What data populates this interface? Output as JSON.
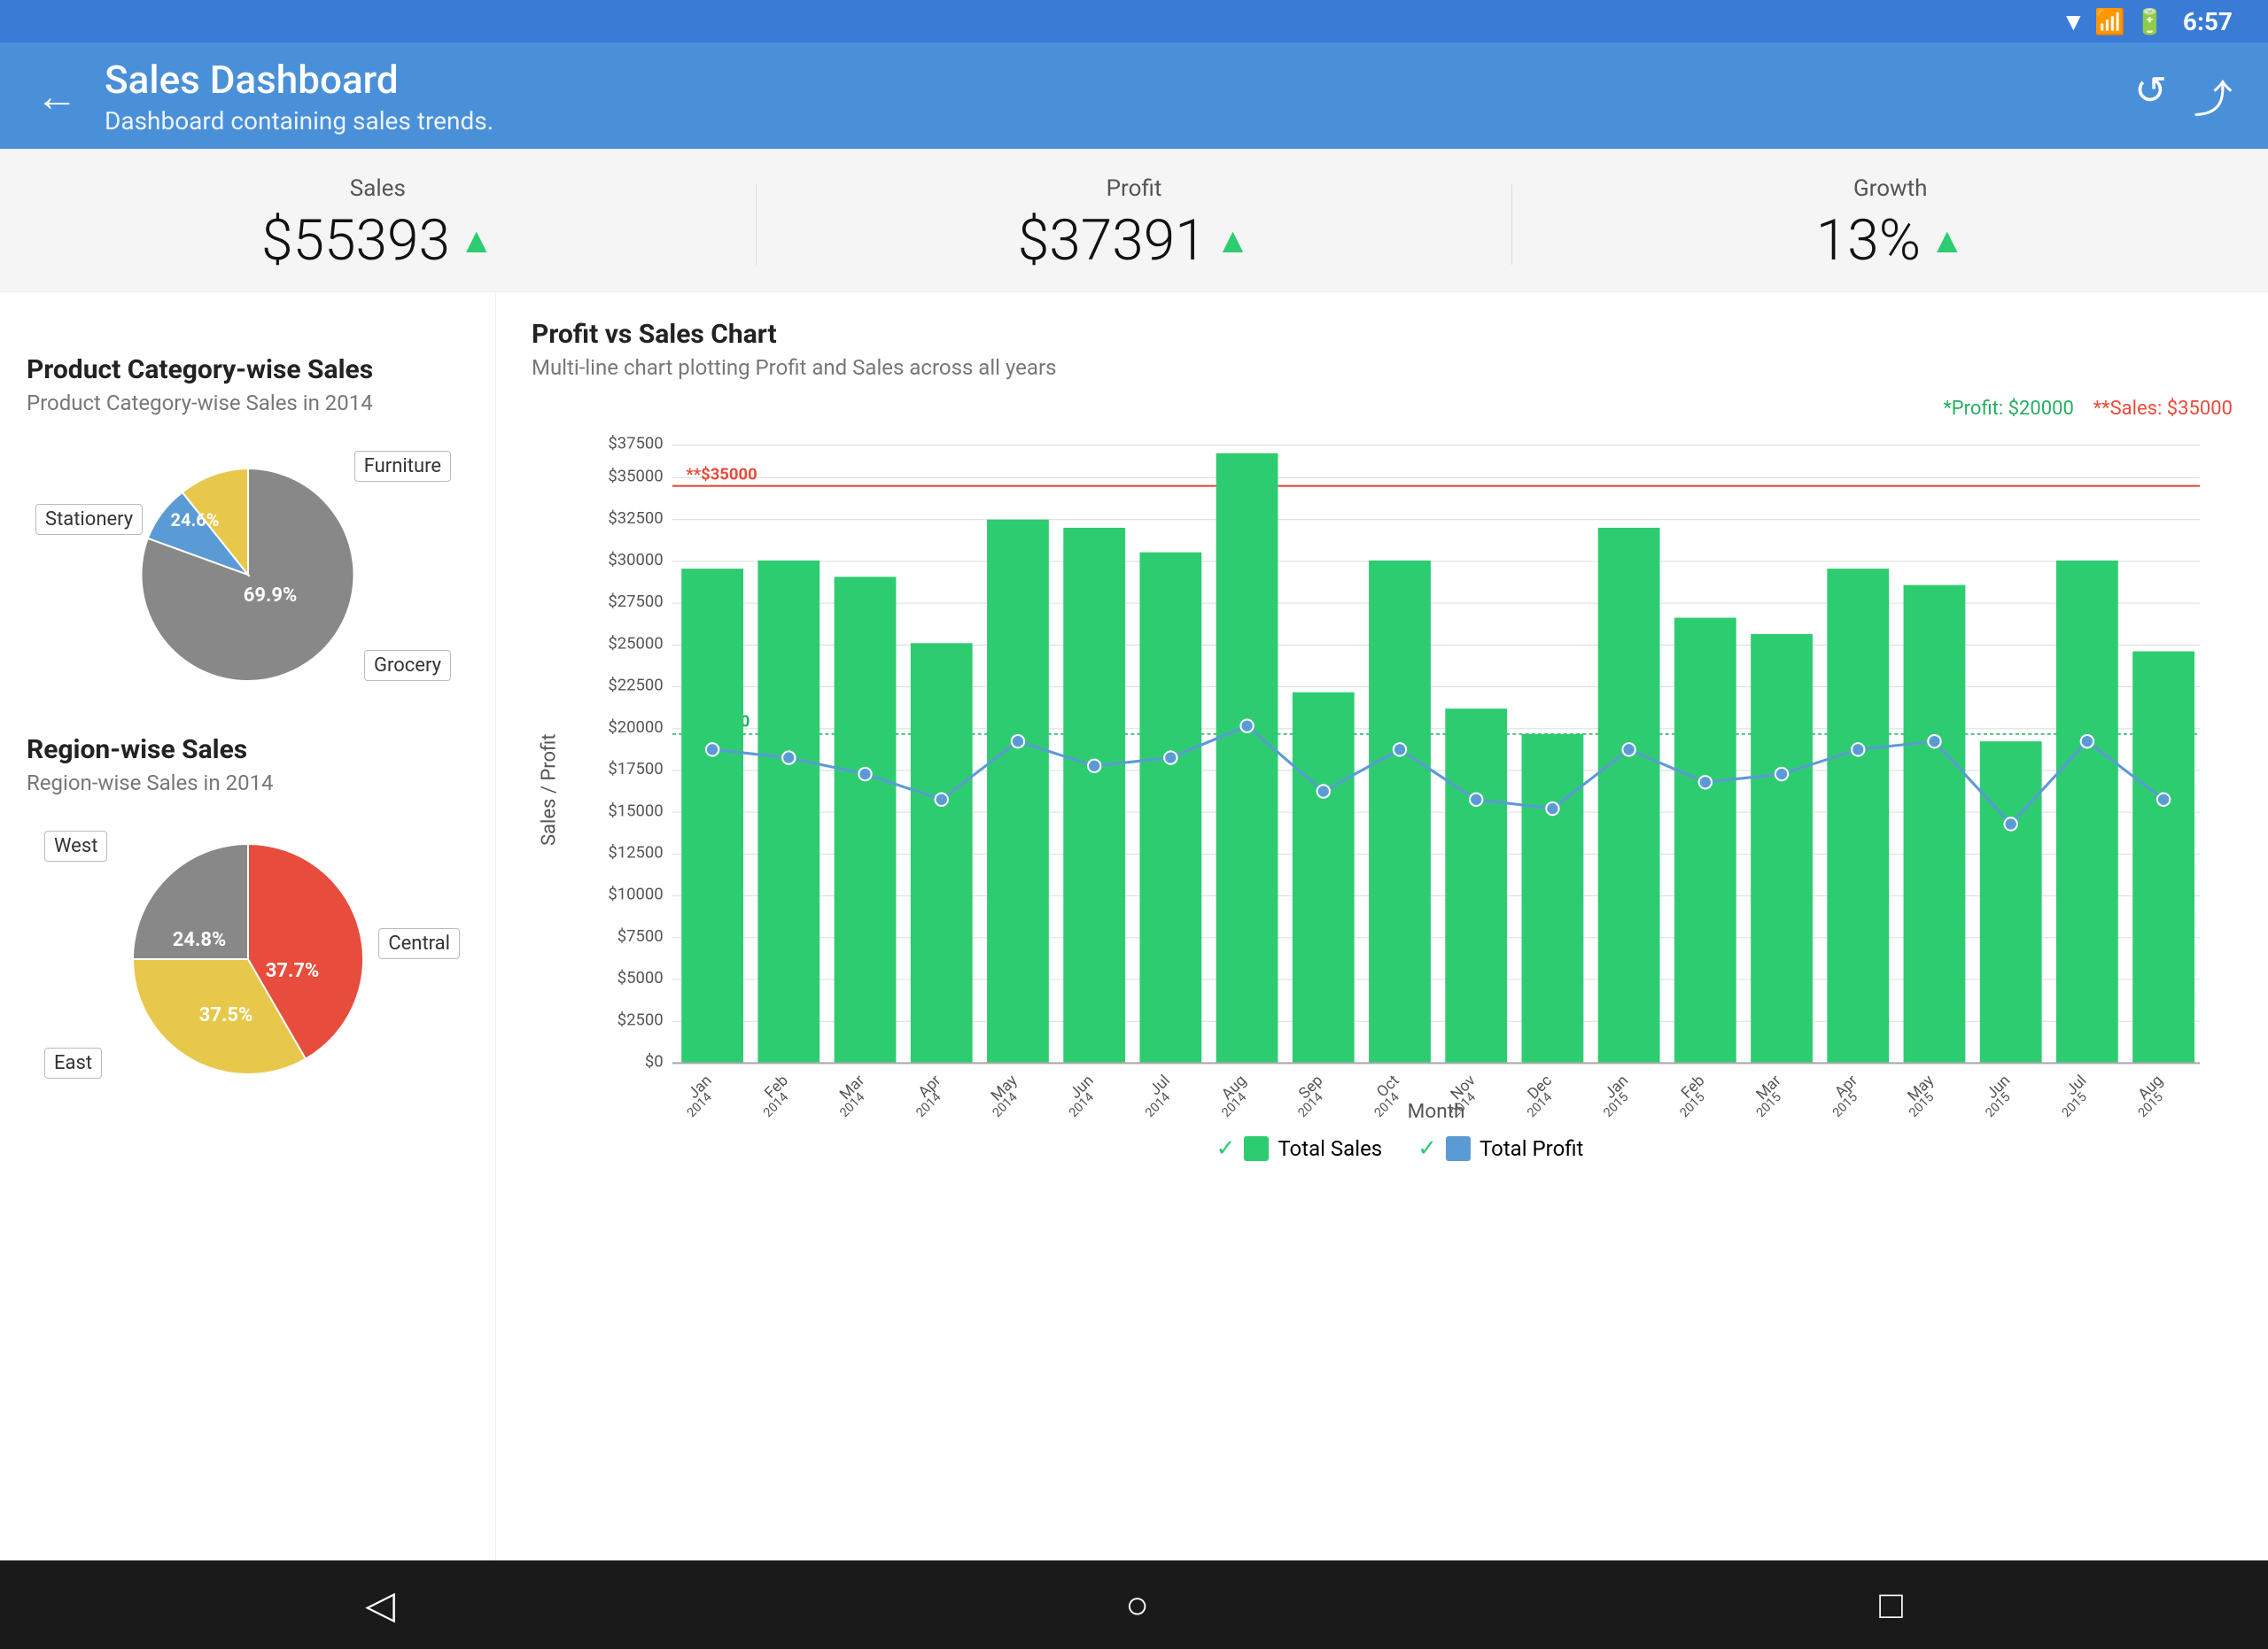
{
  "statusBar": {
    "time": "6:57",
    "icons": [
      "wifi",
      "signal",
      "battery"
    ]
  },
  "appBar": {
    "title": "Sales Dashboard",
    "subtitle": "Dashboard containing sales trends.",
    "backLabel": "←",
    "reloadLabel": "↺",
    "shareLabel": "⤴"
  },
  "kpis": [
    {
      "label": "Sales",
      "value": "$55393",
      "trend": "▲"
    },
    {
      "label": "Profit",
      "value": "$37391",
      "trend": "▲"
    },
    {
      "label": "Growth",
      "value": "13%",
      "trend": "▲"
    }
  ],
  "productChart": {
    "title": "Product Category-wise Sales",
    "subtitle": "Product Category-wise Sales in 2014",
    "segments": [
      {
        "label": "Grocery",
        "percent": 69.9,
        "color": "#888"
      },
      {
        "label": "Furniture",
        "percent": 5.5,
        "color": "#5b9bd5"
      },
      {
        "label": "Stationery",
        "percent": 24.6,
        "color": "#e8c84a"
      }
    ]
  },
  "regionChart": {
    "title": "Region-wise Sales",
    "subtitle": "Region-wise Sales in 2014",
    "segments": [
      {
        "label": "Central",
        "percent": 37.7,
        "color": "#e74c3c"
      },
      {
        "label": "East",
        "percent": 37.5,
        "color": "#e8c84a"
      },
      {
        "label": "West",
        "percent": 24.8,
        "color": "#888"
      }
    ]
  },
  "profitSalesChart": {
    "title": "Profit vs Sales Chart",
    "subtitle": "Multi-line chart plotting Profit and Sales across all years",
    "legendTop": {
      "profit": "*Profit: $20000",
      "sales": "**Sales: $35000"
    },
    "annotations": {
      "salesLine": "**$35000",
      "profitLine": "*$20000"
    },
    "xAxisLabel": "Month",
    "yAxisLabel": "Sales / Profit",
    "months": [
      "Jan\n2014",
      "Feb\n2014",
      "Mar\n2014",
      "Apr\n2014",
      "May\n2014",
      "Jun\n2014",
      "Jul\n2014",
      "Aug\n2014",
      "Sep\n2014",
      "Oct\n2014",
      "Nov\n2014",
      "Dec\n2014",
      "Jan\n2015",
      "Feb\n2015",
      "Mar\n2015",
      "Apr\n2015",
      "May\n2015",
      "Jun\n2015",
      "Jul\n2015",
      "Aug\n2015"
    ],
    "salesBars": [
      30000,
      30500,
      29500,
      25500,
      33000,
      32500,
      31000,
      37000,
      22500,
      30500,
      21500,
      20000,
      32500,
      27000,
      26000,
      30000,
      29000,
      19500,
      30500,
      25000
    ],
    "profitLine": [
      19000,
      18500,
      17500,
      16000,
      19500,
      18000,
      18500,
      20500,
      16500,
      19000,
      16000,
      15500,
      19000,
      17000,
      17500,
      19000,
      19500,
      14500,
      19500,
      16000
    ],
    "yLabels": [
      "$0",
      "$2500",
      "$5000",
      "$7500",
      "$10000",
      "$12500",
      "$15000",
      "$17500",
      "$20000",
      "$22500",
      "$25000",
      "$27500",
      "$30000",
      "$32500",
      "$35000",
      "$37500"
    ],
    "legendBottom": [
      {
        "label": "Total Sales",
        "color": "green"
      },
      {
        "label": "Total Profit",
        "color": "blue"
      }
    ]
  },
  "bottomNav": {
    "back": "◁",
    "home": "○",
    "recent": "□"
  }
}
